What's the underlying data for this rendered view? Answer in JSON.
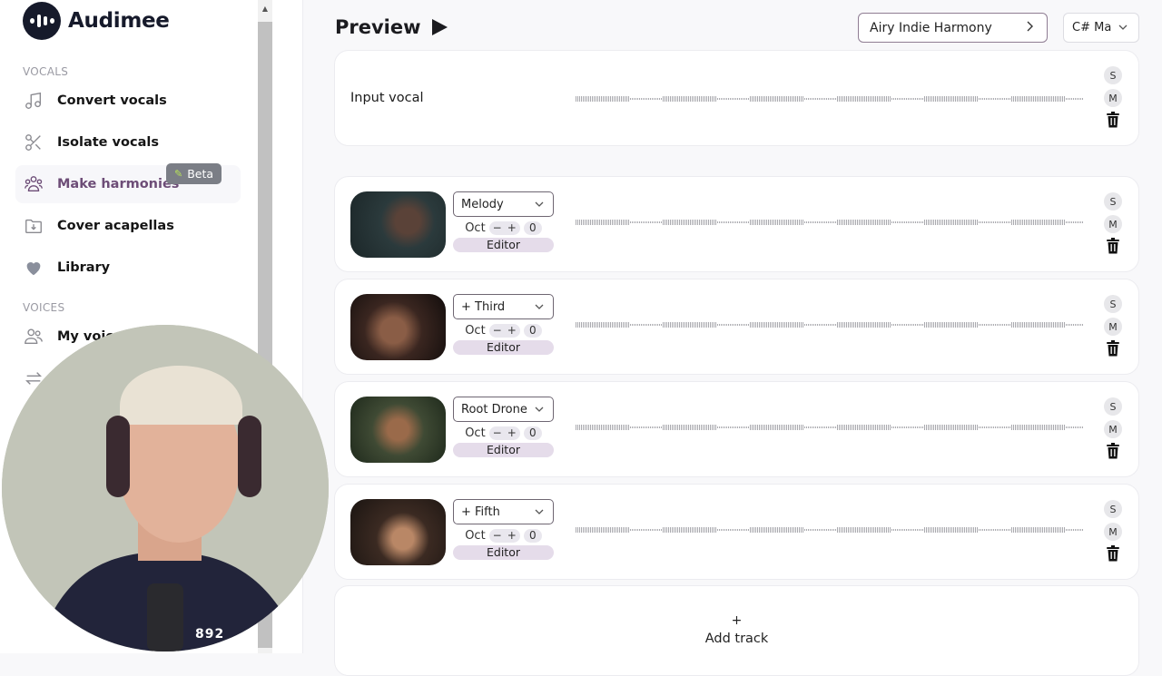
{
  "app": {
    "name": "Audimee"
  },
  "sidebar": {
    "sections": [
      {
        "label": "VOCALS"
      },
      {
        "label": "VOICES"
      }
    ],
    "items": [
      {
        "label": "Convert vocals",
        "icon": "music-note-icon"
      },
      {
        "label": "Isolate vocals",
        "icon": "scissors-icon"
      },
      {
        "label": "Make harmonies",
        "icon": "group-icon",
        "active": true,
        "badge": "Beta"
      },
      {
        "label": "Cover acapellas",
        "icon": "folder-download-icon"
      },
      {
        "label": "Library",
        "icon": "heart-icon"
      },
      {
        "label": "My voic",
        "icon": "users-icon"
      },
      {
        "label": "",
        "icon": "swap-arrows-icon"
      }
    ]
  },
  "header": {
    "title": "Preview",
    "preset": "Airy Indie Harmony",
    "key": "C# Ma"
  },
  "input_track": {
    "label": "Input vocal",
    "solo": "S",
    "mute": "M"
  },
  "tracks": [
    {
      "voice": "Melody",
      "oct_label": "Oct",
      "oct_minus": "−",
      "oct_plus": "+",
      "oct_value": "0",
      "editor": "Editor",
      "solo": "S",
      "mute": "M"
    },
    {
      "voice": "+ Third",
      "oct_label": "Oct",
      "oct_minus": "−",
      "oct_plus": "+",
      "oct_value": "0",
      "editor": "Editor",
      "solo": "S",
      "mute": "M"
    },
    {
      "voice": "Root Drone",
      "oct_label": "Oct",
      "oct_minus": "−",
      "oct_plus": "+",
      "oct_value": "0",
      "editor": "Editor",
      "solo": "S",
      "mute": "M"
    },
    {
      "voice": "+ Fifth",
      "oct_label": "Oct",
      "oct_minus": "−",
      "oct_plus": "+",
      "oct_value": "0",
      "editor": "Editor",
      "solo": "S",
      "mute": "M"
    }
  ],
  "add_track": {
    "plus": "+",
    "label": "Add track"
  },
  "overlay": {
    "webcam_badge": "892"
  },
  "colors": {
    "accent": "#6d4d77",
    "editor_bg": "#e5dcea",
    "logo": "#161a2b"
  }
}
